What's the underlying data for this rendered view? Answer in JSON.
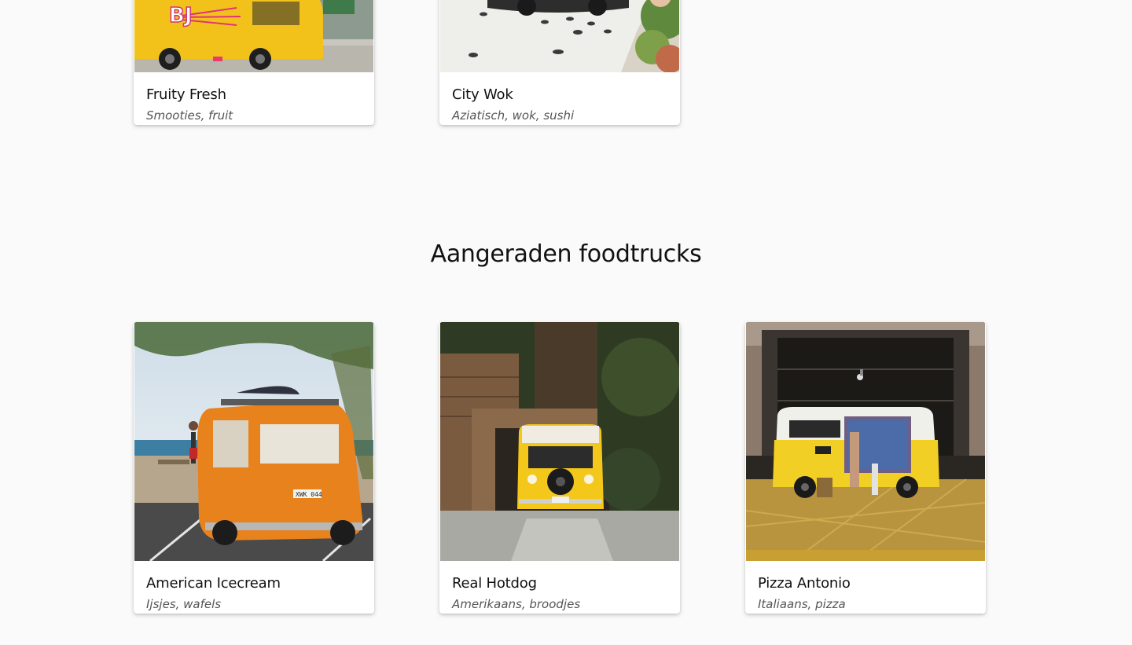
{
  "top_cards": [
    {
      "name": "Fruity Fresh",
      "tags": "Smooties, fruit"
    },
    {
      "name": "City Wok",
      "tags": "Aziatisch, wok, sushi"
    }
  ],
  "section": {
    "title": "Aangeraden foodtrucks"
  },
  "recommended_cards": [
    {
      "name": "American Icecream",
      "tags": "Ijsjes, wafels"
    },
    {
      "name": "Real Hotdog",
      "tags": "Amerikaans, broodjes"
    },
    {
      "name": "Pizza Antonio",
      "tags": "Italiaans, pizza"
    }
  ],
  "image_text": {
    "fruity_logo": "BJ",
    "plate": "XWK 044"
  }
}
